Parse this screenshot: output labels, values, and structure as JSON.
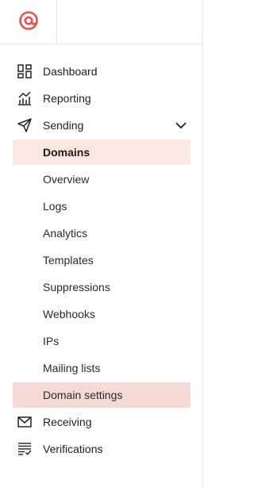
{
  "brand": {
    "logo_icon": "mailgun-at-logo-icon",
    "accent_color": "#e5534b"
  },
  "nav": {
    "dashboard": {
      "label": "Dashboard",
      "icon": "dashboard-grid-icon"
    },
    "reporting": {
      "label": "Reporting",
      "icon": "bar-chart-icon"
    },
    "sending": {
      "label": "Sending",
      "icon": "paper-plane-icon",
      "expanded": true
    },
    "sending_items": [
      {
        "label": "Domains",
        "state": "selected"
      },
      {
        "label": "Overview"
      },
      {
        "label": "Logs"
      },
      {
        "label": "Analytics"
      },
      {
        "label": "Templates"
      },
      {
        "label": "Suppressions"
      },
      {
        "label": "Webhooks"
      },
      {
        "label": "IPs"
      },
      {
        "label": "Mailing lists"
      },
      {
        "label": "Domain settings",
        "state": "highlighted"
      }
    ],
    "receiving": {
      "label": "Receiving",
      "icon": "envelope-icon"
    },
    "verifications": {
      "label": "Verifications",
      "icon": "checklist-icon"
    }
  }
}
